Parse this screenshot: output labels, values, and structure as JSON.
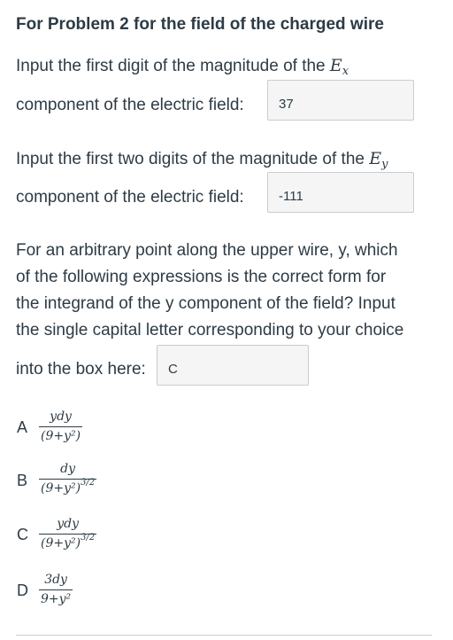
{
  "problem_title": "For Problem 2 for the field of the charged wire",
  "q1": {
    "line1": "Input the first digit of the magnitude of the",
    "symbol": "E",
    "subscript": "x",
    "line2": "component of the electric field:",
    "answer": "37"
  },
  "q2": {
    "line1": "Input the first two digits of the magnitude of the",
    "symbol": "E",
    "subscript": "y",
    "line2": "component of the electric field:",
    "answer": "-111"
  },
  "q3": {
    "lines": [
      "For an arbitrary point along the upper wire, y, which",
      "of the following expressions is the correct form for",
      "the integrand of the y component of the field? Input",
      "the single capital letter corresponding to your choice"
    ],
    "last_line": "into the box here:",
    "answer": "C"
  },
  "options": [
    {
      "letter": "A",
      "numerator": "ydy",
      "denominator": "(9+y²)",
      "exponent": ""
    },
    {
      "letter": "B",
      "numerator": "dy",
      "denominator": "(9+y²)",
      "exponent": "3/2"
    },
    {
      "letter": "C",
      "numerator": "ydy",
      "denominator": "(9+y²)",
      "exponent": "3/2"
    },
    {
      "letter": "D",
      "numerator": "3dy",
      "denominator": "9+y²",
      "exponent": ""
    }
  ]
}
